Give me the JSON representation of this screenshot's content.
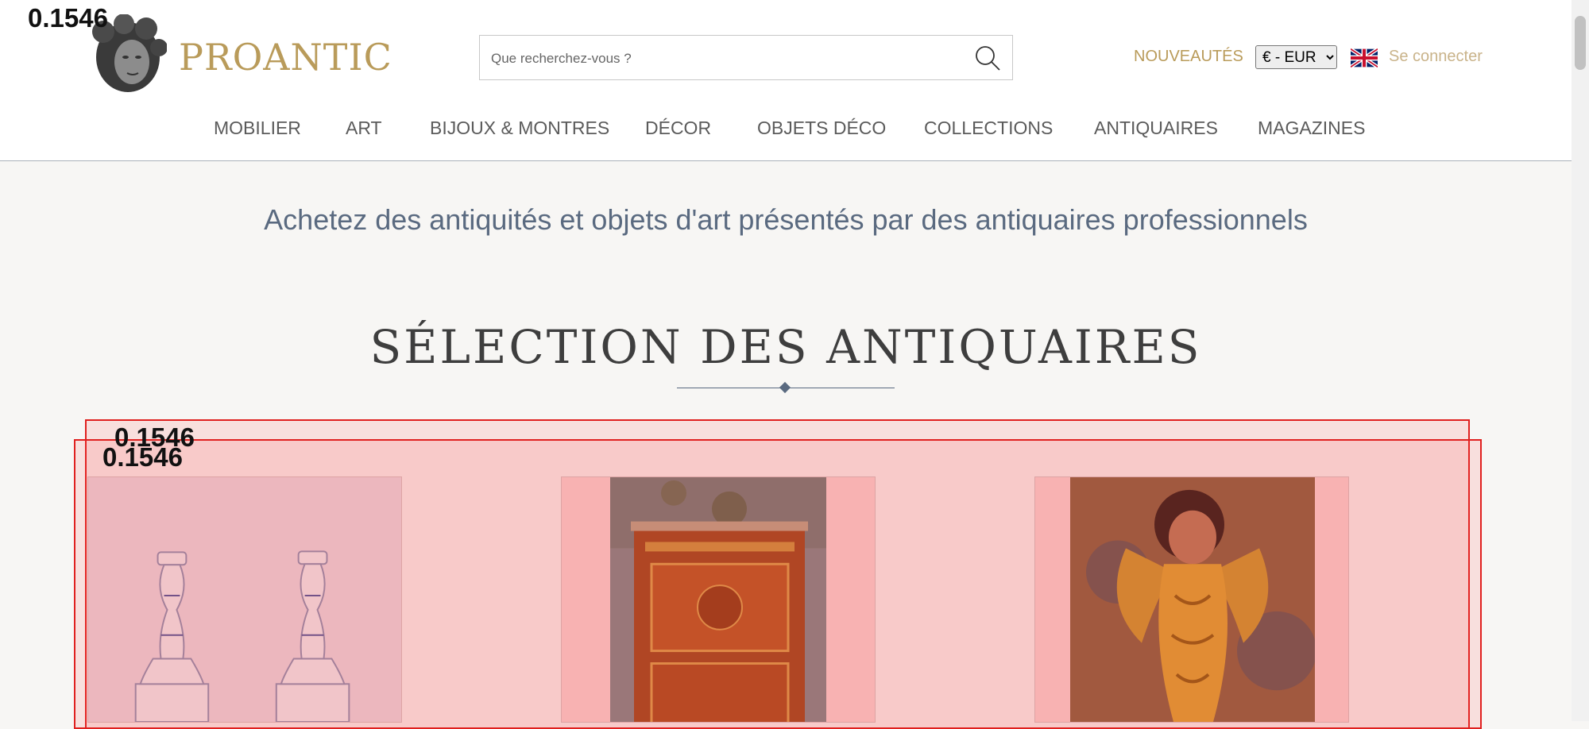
{
  "header": {
    "brand": "PROANTIC",
    "search": {
      "placeholder": "Que recherchez-vous ?"
    },
    "nouveautes": "NOUVEAUTÉS",
    "currency": {
      "selected": "€ - EUR",
      "options": [
        "€ - EUR"
      ]
    },
    "login": "Se connecter"
  },
  "nav": [
    "MOBILIER",
    "ART",
    "BIJOUX & MONTRES",
    "DÉCOR",
    "OBJETS DÉCO",
    "COLLECTIONS",
    "ANTIQUAIRES",
    "MAGAZINES"
  ],
  "main": {
    "tagline": "Achetez des antiquités et objets d'art présentés par des antiquaires professionnels",
    "section_title": "SÉLECTION DES ANTIQUAIRES"
  },
  "overlay": {
    "scores": [
      "0.1546",
      "0.1546",
      "0.1546"
    ]
  },
  "products": [
    {
      "icon": "faience-candlesticks-image"
    },
    {
      "icon": "marquetry-secretaire-image"
    },
    {
      "icon": "gilded-angel-sculpture-image"
    }
  ],
  "colors": {
    "accent_gold": "#b99b5a",
    "tagline_blue": "#5a6a80",
    "overlay_red": "#e0201f"
  }
}
